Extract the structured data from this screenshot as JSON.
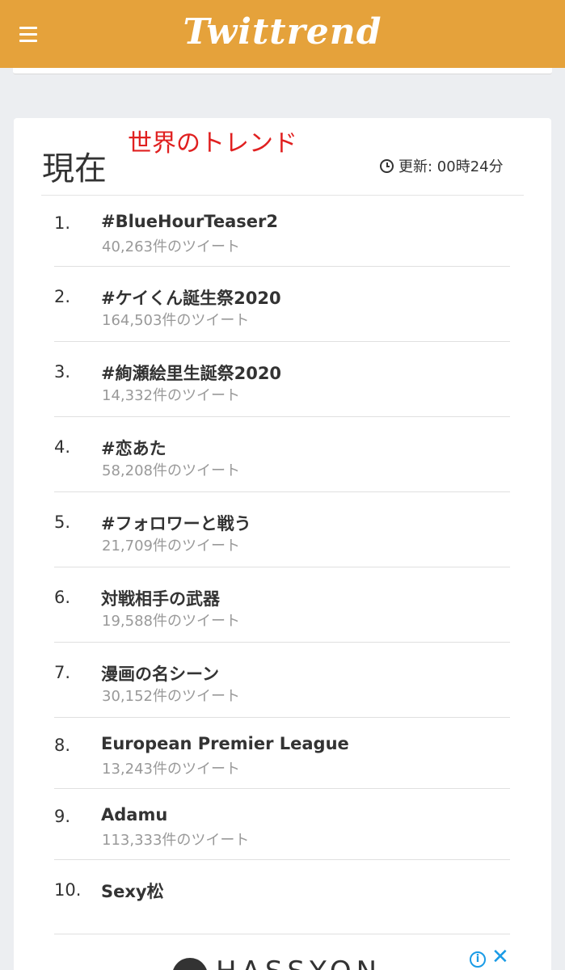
{
  "header": {
    "logo": "Twittrend",
    "menu_icon": "hamburger-menu-icon"
  },
  "panel": {
    "title": "現在",
    "annotation": "世界のトレンド",
    "updated_label": "更新: 00時24分"
  },
  "trends": [
    {
      "rank": "1.",
      "name": "#BlueHourTeaser2",
      "count": "40,263件のツイート"
    },
    {
      "rank": "2.",
      "name": "#ケイくん誕生祭2020",
      "count": "164,503件のツイート"
    },
    {
      "rank": "3.",
      "name": "#絢瀬絵里生誕祭2020",
      "count": "14,332件のツイート"
    },
    {
      "rank": "4.",
      "name": "#恋あた",
      "count": "58,208件のツイート"
    },
    {
      "rank": "5.",
      "name": "#フォロワーと戦う",
      "count": "21,709件のツイート"
    },
    {
      "rank": "6.",
      "name": "対戦相手の武器",
      "count": "19,588件のツイート"
    },
    {
      "rank": "7.",
      "name": "漫画の名シーン",
      "count": "30,152件のツイート"
    },
    {
      "rank": "8.",
      "name": "European Premier League",
      "count": "13,243件のツイート"
    },
    {
      "rank": "9.",
      "name": "Adamu",
      "count": "113,333件のツイート"
    },
    {
      "rank": "10.",
      "name": "Sexy松",
      "count": ""
    }
  ],
  "ad": {
    "text": "HASSYON",
    "info_icon": "info-icon",
    "close_icon": "close-icon"
  },
  "colors": {
    "brand": "#e5a23b",
    "annotation": "#e02020",
    "ad_accent": "#1a9be6"
  }
}
